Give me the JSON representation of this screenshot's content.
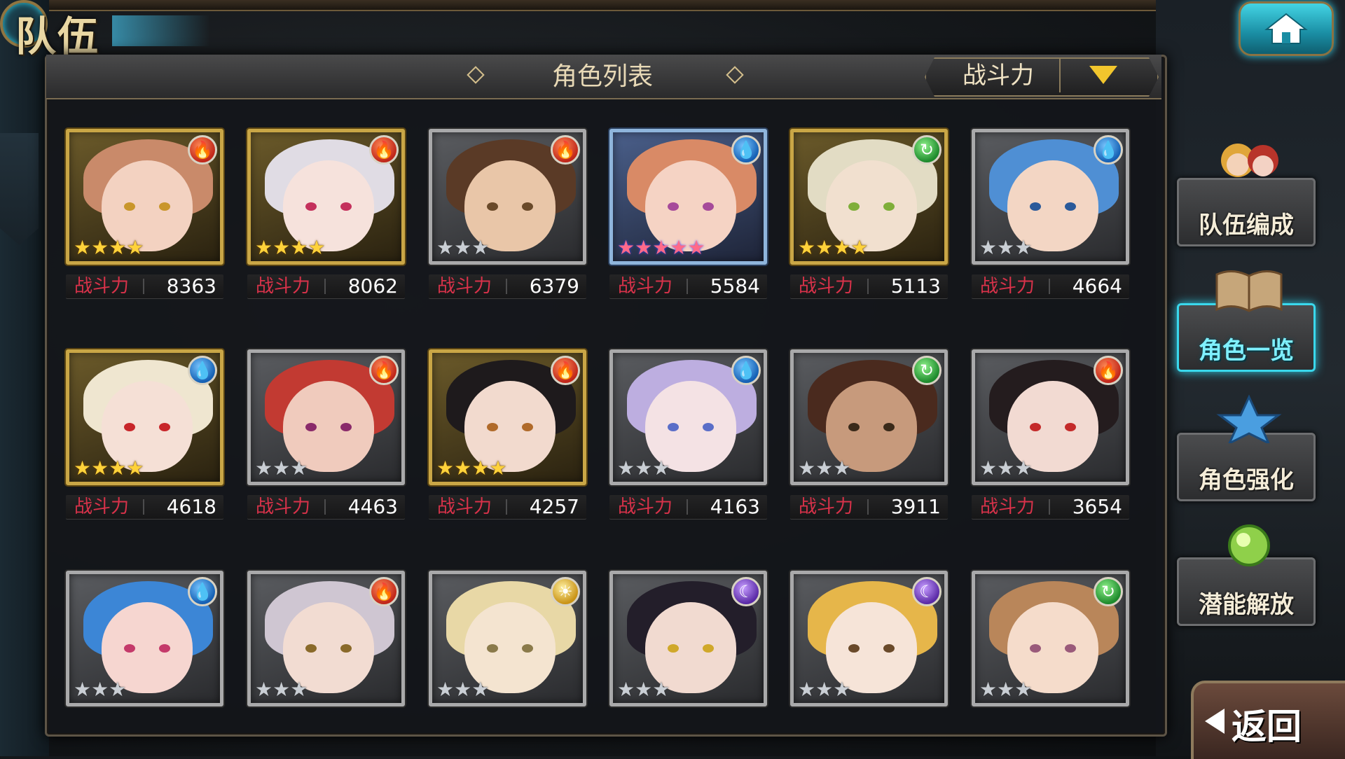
{
  "header": {
    "title": "队伍",
    "home_icon": "home-icon"
  },
  "panel": {
    "title": "角色列表",
    "sort_label": "战斗力",
    "sort_arrow_icon": "chevron-down-icon"
  },
  "power_label": "战斗力",
  "characters": [
    {
      "element": "fire",
      "rarity": 4,
      "star_type": "gold",
      "frame": "gold",
      "power": "8363",
      "hair": "#c98a6a",
      "skin": "#f3d2c1",
      "eye": "#c9962b"
    },
    {
      "element": "fire",
      "rarity": 4,
      "star_type": "gold",
      "frame": "gold",
      "power": "8062",
      "hair": "#e0dce4",
      "skin": "#f6e2dc",
      "eye": "#c4305c"
    },
    {
      "element": "fire",
      "rarity": 3,
      "star_type": "silver",
      "frame": "silver",
      "power": "6379",
      "hair": "#5a3a26",
      "skin": "#e9c6a8",
      "eye": "#6a4a2a"
    },
    {
      "element": "water",
      "rarity": 5,
      "star_type": "rainbow",
      "frame": "blue",
      "power": "5584",
      "hair": "#d98a66",
      "skin": "#f5d3c4",
      "eye": "#a64a9a"
    },
    {
      "element": "wind",
      "rarity": 4,
      "star_type": "gold",
      "frame": "gold",
      "power": "5113",
      "hair": "#e2dcc4",
      "skin": "#f1e0cf",
      "eye": "#7fae3a"
    },
    {
      "element": "water",
      "rarity": 3,
      "star_type": "silver",
      "frame": "silver",
      "power": "4664",
      "hair": "#4f8fd4",
      "skin": "#f3d6c4",
      "eye": "#2a5a9a"
    },
    {
      "element": "water",
      "rarity": 4,
      "star_type": "gold",
      "frame": "gold",
      "power": "4618",
      "hair": "#efe6d0",
      "skin": "#f5e0d6",
      "eye": "#c8262a"
    },
    {
      "element": "fire",
      "rarity": 3,
      "star_type": "silver",
      "frame": "silver",
      "power": "4463",
      "hair": "#c23a32",
      "skin": "#f0cbbd",
      "eye": "#8a2a6a"
    },
    {
      "element": "fire",
      "rarity": 4,
      "star_type": "gold",
      "frame": "gold",
      "power": "4257",
      "hair": "#1e1a1c",
      "skin": "#f2dace",
      "eye": "#b06a2a"
    },
    {
      "element": "water",
      "rarity": 3,
      "star_type": "silver",
      "frame": "silver",
      "power": "4163",
      "hair": "#bdaee0",
      "skin": "#f4e2e4",
      "eye": "#5a6ec8"
    },
    {
      "element": "wind",
      "rarity": 3,
      "star_type": "silver",
      "frame": "silver",
      "power": "3911",
      "hair": "#4a2a1e",
      "skin": "#c79a7c",
      "eye": "#3a2a1a"
    },
    {
      "element": "fire",
      "rarity": 3,
      "star_type": "silver",
      "frame": "silver",
      "power": "3654",
      "hair": "#241c1e",
      "skin": "#f2dad2",
      "eye": "#c42a2a"
    },
    {
      "element": "water",
      "rarity": 3,
      "star_type": "silver",
      "frame": "silver",
      "power": "",
      "hair": "#3c86d6",
      "skin": "#f6d6d0",
      "eye": "#c43a6a"
    },
    {
      "element": "fire",
      "rarity": 3,
      "star_type": "silver",
      "frame": "silver",
      "power": "",
      "hair": "#cfc6d2",
      "skin": "#f2dcd2",
      "eye": "#8a6a2a"
    },
    {
      "element": "light",
      "rarity": 3,
      "star_type": "silver",
      "frame": "silver",
      "power": "",
      "hair": "#e8d8a6",
      "skin": "#f4e4d0",
      "eye": "#8a7a4a"
    },
    {
      "element": "dark",
      "rarity": 3,
      "star_type": "silver",
      "frame": "silver",
      "power": "",
      "hair": "#231e2a",
      "skin": "#f1dad0",
      "eye": "#d0a82a"
    },
    {
      "element": "dark",
      "rarity": 3,
      "star_type": "silver",
      "frame": "silver",
      "power": "",
      "hair": "#e6b64a",
      "skin": "#f6e4d8",
      "eye": "#6a4a2a"
    },
    {
      "element": "wind",
      "rarity": 3,
      "star_type": "silver",
      "frame": "silver",
      "power": "",
      "hair": "#b9865a",
      "skin": "#f5dccb",
      "eye": "#9a5a7a"
    }
  ],
  "side_menu": [
    {
      "label": "队伍编成",
      "icon": "team-members-icon",
      "active": false
    },
    {
      "label": "角色一览",
      "icon": "book-icon",
      "active": true
    },
    {
      "label": "角色强化",
      "icon": "power-up-icon",
      "active": false
    },
    {
      "label": "潜能解放",
      "icon": "orb-icon",
      "active": false
    }
  ],
  "back_button": {
    "label": "返回",
    "icon": "back-arrow-icon"
  },
  "colors": {
    "accent_cyan": "#3ad8ec",
    "power_label": "#d9324a",
    "sort_arrow": "#f2c62d"
  }
}
